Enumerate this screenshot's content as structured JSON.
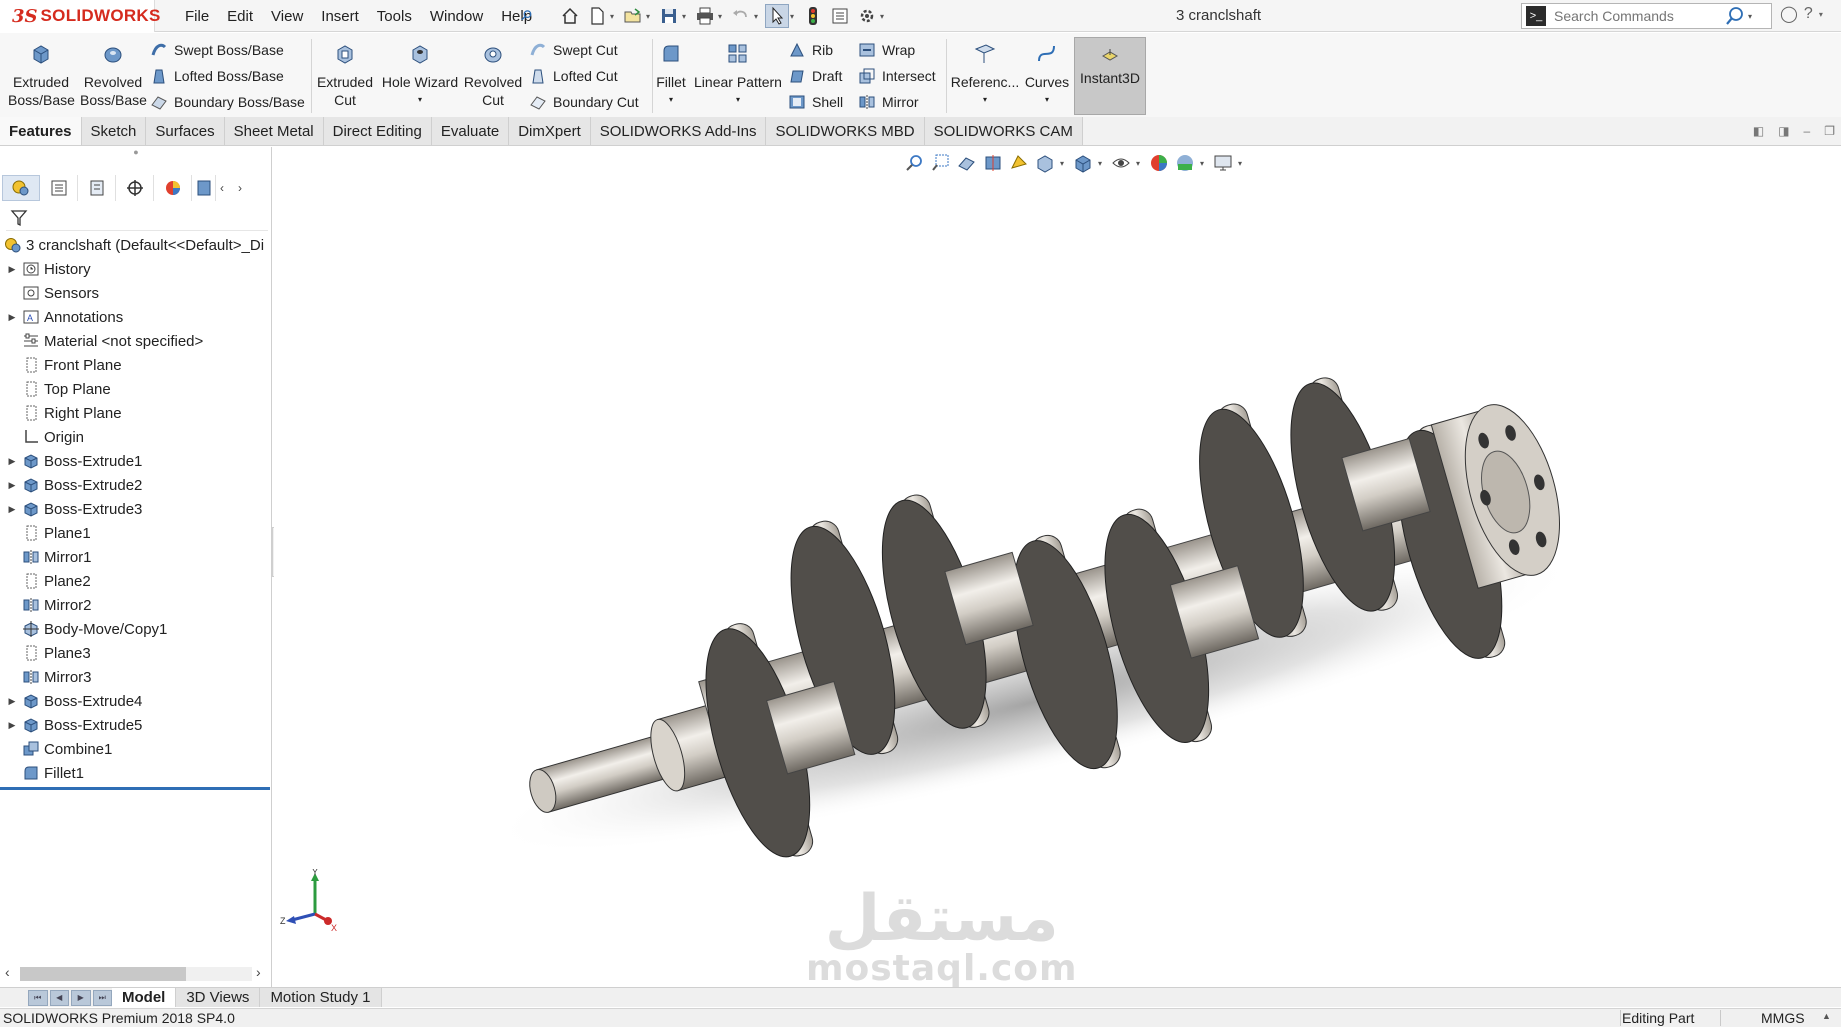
{
  "app": {
    "brand_ds": "3S",
    "brand_name": "SOLIDWORKS",
    "document_title": "3 cranclshaft",
    "colors": {
      "brand_red": "#d52b1e",
      "accent_blue": "#2e6eb5",
      "part_dark": "#4f4c49",
      "part_light": "#d8d4cd"
    }
  },
  "menu": [
    "File",
    "Edit",
    "View",
    "Insert",
    "Tools",
    "Window",
    "Help"
  ],
  "search": {
    "placeholder": "Search Commands",
    "value": ""
  },
  "command_manager": {
    "extruded_boss": [
      "Extruded",
      "Boss/Base"
    ],
    "revolved_boss": [
      "Revolved",
      "Boss/Base"
    ],
    "swept_boss": "Swept Boss/Base",
    "lofted_boss": "Lofted Boss/Base",
    "boundary_boss": "Boundary Boss/Base",
    "extruded_cut": [
      "Extruded",
      "Cut"
    ],
    "hole_wizard": "Hole Wizard",
    "revolved_cut": [
      "Revolved",
      "Cut"
    ],
    "swept_cut": "Swept Cut",
    "lofted_cut": "Lofted Cut",
    "boundary_cut": "Boundary Cut",
    "fillet": "Fillet",
    "linear_pattern": "Linear Pattern",
    "rib": "Rib",
    "draft": "Draft",
    "shell": "Shell",
    "wrap": "Wrap",
    "intersect": "Intersect",
    "mirror": "Mirror",
    "reference": "Referenc...",
    "curves": "Curves",
    "instant3d": "Instant3D"
  },
  "tabs": [
    "Features",
    "Sketch",
    "Surfaces",
    "Sheet Metal",
    "Direct Editing",
    "Evaluate",
    "DimXpert",
    "SOLIDWORKS Add-Ins",
    "SOLIDWORKS MBD",
    "SOLIDWORKS CAM"
  ],
  "feature_tree": {
    "root": "3 cranclshaft  (Default<<Default>_Di",
    "items": [
      {
        "label": "History",
        "icon": "history-folder-icon",
        "expandable": true
      },
      {
        "label": "Sensors",
        "icon": "sensors-icon",
        "expandable": false
      },
      {
        "label": "Annotations",
        "icon": "annotations-icon",
        "expandable": true
      },
      {
        "label": "Material <not specified>",
        "icon": "material-icon",
        "expandable": false
      },
      {
        "label": "Front Plane",
        "icon": "plane-icon",
        "expandable": false
      },
      {
        "label": "Top Plane",
        "icon": "plane-icon",
        "expandable": false
      },
      {
        "label": "Right Plane",
        "icon": "plane-icon",
        "expandable": false
      },
      {
        "label": "Origin",
        "icon": "origin-icon",
        "expandable": false
      },
      {
        "label": "Boss-Extrude1",
        "icon": "boss-extrude-icon",
        "expandable": true
      },
      {
        "label": "Boss-Extrude2",
        "icon": "boss-extrude-icon",
        "expandable": true
      },
      {
        "label": "Boss-Extrude3",
        "icon": "boss-extrude-icon",
        "expandable": true
      },
      {
        "label": "Plane1",
        "icon": "plane-icon",
        "expandable": false
      },
      {
        "label": "Mirror1",
        "icon": "mirror-icon",
        "expandable": false
      },
      {
        "label": "Plane2",
        "icon": "plane-icon",
        "expandable": false
      },
      {
        "label": "Mirror2",
        "icon": "mirror-icon",
        "expandable": false
      },
      {
        "label": "Body-Move/Copy1",
        "icon": "move-copy-icon",
        "expandable": false
      },
      {
        "label": "Plane3",
        "icon": "plane-icon",
        "expandable": false
      },
      {
        "label": "Mirror3",
        "icon": "mirror-icon",
        "expandable": false
      },
      {
        "label": "Boss-Extrude4",
        "icon": "boss-extrude-icon",
        "expandable": true
      },
      {
        "label": "Boss-Extrude5",
        "icon": "boss-extrude-icon",
        "expandable": true
      },
      {
        "label": "Combine1",
        "icon": "combine-icon",
        "expandable": false
      },
      {
        "label": "Fillet1",
        "icon": "fillet-icon",
        "expandable": false
      }
    ]
  },
  "triad": {
    "y": "Y",
    "z": "Z",
    "x": "X"
  },
  "watermark": {
    "arabic": "مستقل",
    "latin": "mostaql.com"
  },
  "bottom_tabs": [
    "Model",
    "3D Views",
    "Motion Study 1"
  ],
  "status": {
    "version": "SOLIDWORKS Premium 2018 SP4.0",
    "mode": "Editing Part",
    "units": "MMGS"
  }
}
